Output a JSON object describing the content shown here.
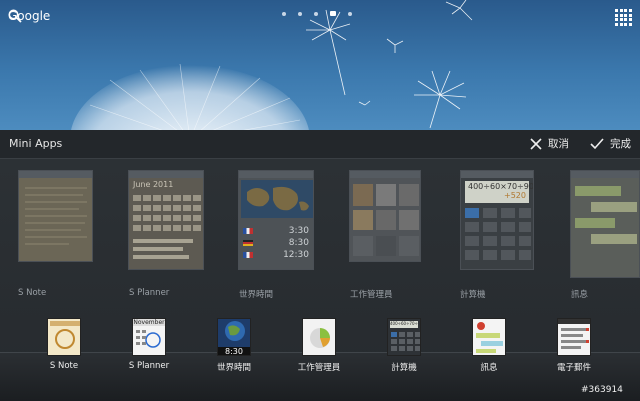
{
  "wallpaper": {
    "search_label": "Google",
    "page_dots": 5,
    "active_dot": 3
  },
  "panel": {
    "title": "Mini Apps",
    "cancel_label": "取消",
    "done_label": "完成"
  },
  "mini_apps": [
    {
      "label": "S Note"
    },
    {
      "label": "S Planner",
      "calendar_month": "June 2011"
    },
    {
      "label": "世界時間",
      "times": [
        "3:30",
        "8:30",
        "12:30"
      ]
    },
    {
      "label": "工作管理員"
    },
    {
      "label": "計算機",
      "display": "400÷60×70÷90",
      "result": "+520"
    },
    {
      "label": "訊息"
    }
  ],
  "dock": [
    {
      "label": "S Note"
    },
    {
      "label": "S Planner",
      "month": "November"
    },
    {
      "label": "世界時間",
      "time": "8:30"
    },
    {
      "label": "工作管理員"
    },
    {
      "label": "計算機",
      "display": "400÷60÷70÷90"
    },
    {
      "label": "訊息"
    },
    {
      "label": "電子郵件"
    }
  ],
  "watermark": "#363914",
  "colors": {
    "wallpaper": "#3b78ad",
    "panel": "#2a2e32"
  }
}
